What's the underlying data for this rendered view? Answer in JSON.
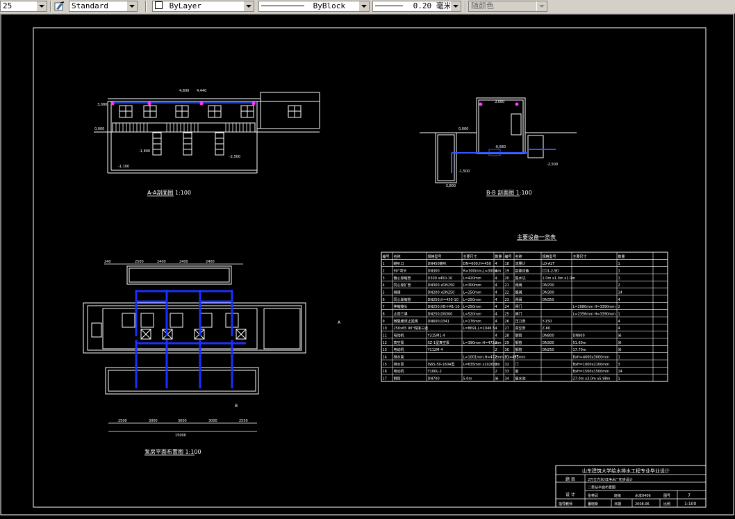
{
  "toolbar": {
    "text_style_partial": "25",
    "style_name": "Standard",
    "layer": "ByLayer",
    "linetype": "ByBlock",
    "lineweight": "0.20 毫米",
    "plot_style": "随颜色",
    "icons": [
      "text-style-icon",
      "color-swatch-icon"
    ]
  },
  "drawing": {
    "section_aa": {
      "caption": "A-A剖面图 1:100",
      "dims_top": [
        "4,800",
        "4,440"
      ],
      "levels": [
        "3,080",
        "0,000",
        "-1,100",
        "-1,800",
        "-2,500"
      ]
    },
    "section_bb": {
      "caption": "B-B 剖面图 1:100",
      "levels": [
        "3,080",
        "0,000",
        "-0,680",
        "-1,500",
        "-2,500",
        "-3,800"
      ]
    },
    "plan": {
      "caption": "泵房平面布置图 1:100",
      "dims_top": [
        "240",
        "2500",
        "2400",
        "2400",
        "2400"
      ],
      "dims_bottom": [
        "2500",
        "3000",
        "3000",
        "3000",
        "2550"
      ],
      "total": "15000",
      "marks": [
        "A",
        "B"
      ]
    },
    "table": {
      "title": "主要设备一览表",
      "headers": [
        "编号",
        "名称",
        "规格型号",
        "主要尺寸",
        "数量",
        "编号",
        "名称",
        "规格型号",
        "主要尺寸",
        "数量"
      ],
      "rows": [
        [
          "1",
          "喇叭口",
          "DN450喇叭",
          "DN=600,H=450",
          "4",
          "18",
          "流量计",
          "LD-A2T",
          "",
          "1"
        ],
        [
          "2",
          "90°弯头",
          "DN300",
          "R=300mm,L=300mm",
          "4",
          "19",
          "起重设备",
          "CD1-2-9D",
          "",
          "1"
        ],
        [
          "3",
          "偏心渐缩管",
          "D300 x450-10",
          "L=420mm",
          "4",
          "20",
          "集水坑",
          "1.0m x1.0m x1.0m",
          "",
          "1"
        ],
        [
          "4",
          "同心渐扩管",
          "DN300 xDN250",
          "L=300mm",
          "4",
          "21",
          "闸阀",
          "DN700",
          "",
          "2"
        ],
        [
          "5",
          "闸阀",
          "DN200 xDN250",
          "L=250mm",
          "4",
          "22",
          "蝶阀",
          "DN300",
          "",
          "14"
        ],
        [
          "6",
          "同心渐缩管",
          "DN250,H=450-10",
          "L=250mm",
          "4",
          "23",
          "闸阀",
          "DN350",
          "",
          "4"
        ],
        [
          "7",
          "伸缩接头",
          "DN250,HB-H41-10",
          "L=250mm",
          "4",
          "24",
          "闸门",
          "",
          "L=2080mm H=3390mm",
          "2"
        ],
        [
          "8",
          "止回三通",
          "DN250,DN300",
          "L=520mm",
          "4",
          "25",
          "闸门",
          "",
          "L=2356mm H=3390mm",
          "1"
        ],
        [
          "9",
          "微阻缓闭止回阀",
          "DN600,0341",
          "L=176mm",
          "4",
          "26",
          "压力表",
          "Y-150",
          "",
          "4"
        ],
        [
          "10",
          "250x65 90°焊接三通",
          "",
          "L=8691,L=1046.5",
          "4",
          "27",
          "真空表",
          "Z-60",
          "",
          "4"
        ],
        [
          "11",
          "电动机",
          "Y315M1-4",
          "",
          "4",
          "28",
          "钢管",
          "DN800",
          "DN800",
          "米"
        ],
        [
          "12",
          "真空泵",
          "SZ-1型真空泵",
          "L=390mm H=472mm",
          "2",
          "29",
          "钢管",
          "DN300",
          "51.60m",
          "米"
        ],
        [
          "13",
          "电动机",
          "Y112M-4",
          "",
          "2",
          "30",
          "钢管",
          "DN250",
          "17.70m",
          "米"
        ],
        [
          "14",
          "排水泵",
          "",
          "L=1001mm,H=472mm B1=495mm",
          "2",
          "31",
          "门",
          "",
          "BxH=4000x3000mm",
          "1"
        ],
        [
          "15",
          "排水泵",
          "IS65-50-160A型",
          "L=635mm x1020mm",
          "2",
          "32",
          "门",
          "",
          "BxH=1000x2100mm",
          "3"
        ],
        [
          "16",
          "电动机",
          "Y100L-2",
          "",
          "2",
          "33",
          "窗",
          "",
          "BxH=1500x1500mm",
          "14"
        ],
        [
          "17",
          "钢管",
          "DN700",
          "5.0m",
          "米",
          "34",
          "集水池",
          "",
          "27.0m x3.0m x5.98m",
          "1"
        ]
      ]
    },
    "title_block": {
      "school": "山东建筑大学给水排水工程专业毕业设计",
      "label_project": "题 目",
      "project": "2万立方米/日净水厂初步设计",
      "drawing_name": "二泵站平面布置图",
      "label_designer": "设 计",
      "designer": "张英武",
      "label_class": "班级",
      "class_name": "水本0406",
      "label_no": "图号",
      "drawing_no": "7",
      "label_tutor": "指导教师",
      "tutor": "董晓新",
      "label_date": "日期",
      "date": "2008.06",
      "label_scale": "比例",
      "scale": "1:100"
    }
  }
}
